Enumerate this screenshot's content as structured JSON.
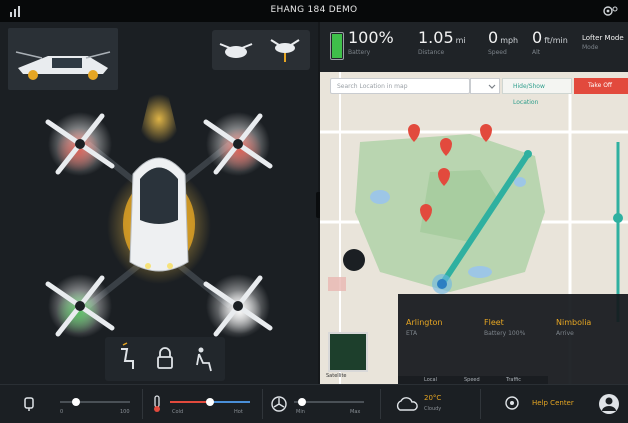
{
  "app": {
    "title": "EHANG 184 DEMO"
  },
  "stats": {
    "battery": {
      "value": "100%",
      "label": "Battery",
      "level": 1.0
    },
    "distance": {
      "value": "1.05",
      "unit": "mi",
      "label": "Distance"
    },
    "speed": {
      "value": "0",
      "unit": "mph",
      "label": "Speed"
    },
    "altitude": {
      "value": "0",
      "unit": "ft/min",
      "label": "Alt"
    },
    "mode": {
      "value": "Lofter Mode",
      "label": "Mode"
    }
  },
  "map": {
    "search_placeholder": "Search Location in map",
    "link_label": "Hide/Show Location",
    "red_button_label": "Take Off",
    "minimap_label": "Satellite",
    "scale_tabs": [
      "Local",
      "Speed",
      "Traffic"
    ]
  },
  "info": [
    {
      "label": "Arlington",
      "sub": "ETA"
    },
    {
      "label": "Fleet",
      "sub": "Battery 100%"
    },
    {
      "label": "Nimbolia",
      "sub": "Arrive"
    }
  ],
  "toolbar": {
    "light_min": "0",
    "light_max": "100",
    "temp_min": "Cold",
    "temp_max": "Hot",
    "fan_min": "Min",
    "fan_max": "Max",
    "weather_text": "20°C",
    "weather_sub": "Cloudy",
    "help_text": "Help Center"
  },
  "colors": {
    "accent": "#e6a623",
    "route": "#2fb0a0",
    "danger": "#e24a3d",
    "battery": "#3fbf4a"
  }
}
